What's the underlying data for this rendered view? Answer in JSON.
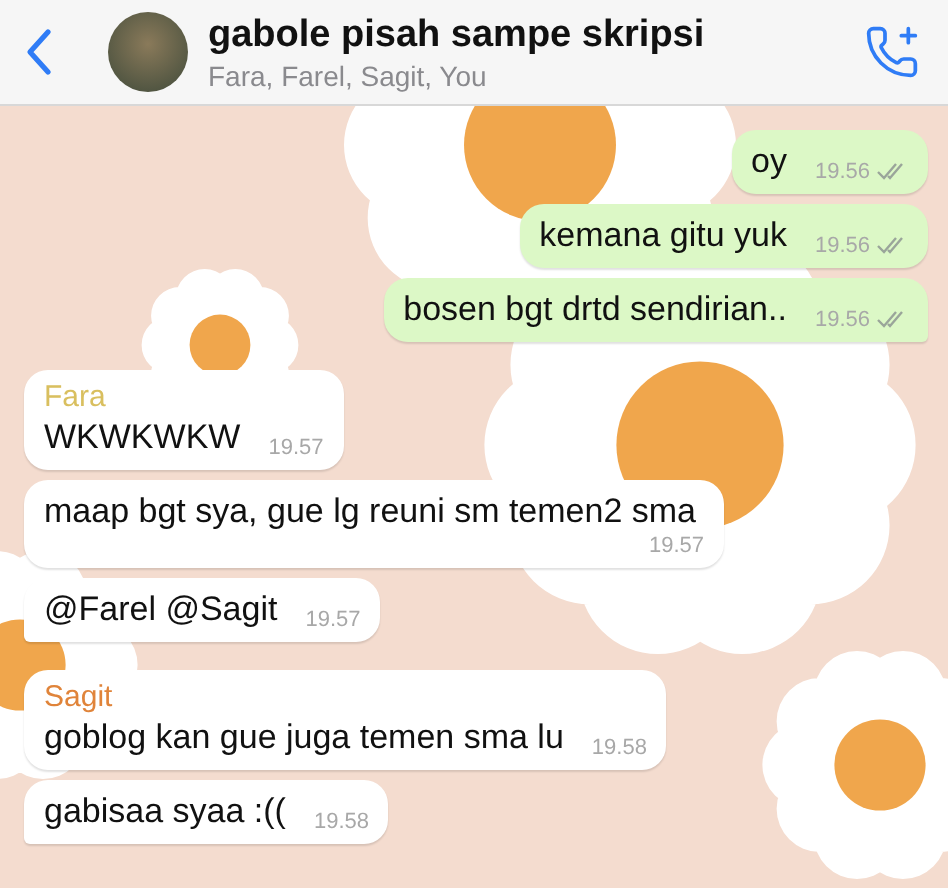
{
  "header": {
    "title": "gabole pisah sampe skripsi",
    "subtitle": "Fara, Farel, Sagit, You"
  },
  "messages": [
    {
      "kind": "outgoing",
      "text": "oy",
      "time": "19.56",
      "delivered": true,
      "tail": false
    },
    {
      "kind": "outgoing",
      "text": "kemana gitu yuk",
      "time": "19.56",
      "delivered": true,
      "tail": false
    },
    {
      "kind": "outgoing",
      "text": "bosen bgt drtd sendirian..",
      "time": "19.56",
      "delivered": true,
      "tail": true
    },
    {
      "kind": "incoming",
      "sender": "Fara",
      "color": "#d9bf5f",
      "text": "WKWKWKW",
      "time": "19.57",
      "tail": false
    },
    {
      "kind": "incoming",
      "text": "maap bgt sya, gue lg reuni sm temen2 sma",
      "time": "19.57",
      "tail": false
    },
    {
      "kind": "incoming",
      "text": "@Farel @Sagit",
      "time": "19.57",
      "tail": true
    },
    {
      "kind": "incoming",
      "sender": "Sagit",
      "color": "#e0843a",
      "text": "goblog kan gue juga temen sma lu",
      "time": "19.58",
      "tail": false
    },
    {
      "kind": "incoming",
      "text": "gabisaa syaa :((",
      "time": "19.58",
      "tail": true
    }
  ]
}
